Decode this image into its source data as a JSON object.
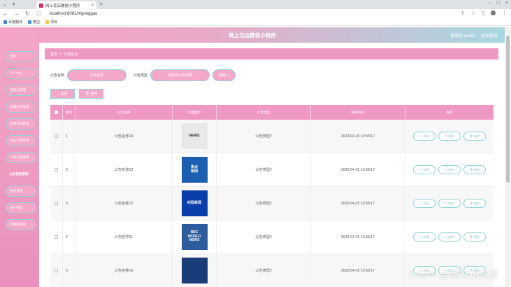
{
  "browser": {
    "tab_title": "网上花店微信小程序",
    "url": "localhost:8081/#/gonggao",
    "bookmarks": [
      {
        "label": "百度翻译",
        "color": "#3b7ddd"
      },
      {
        "label": "爬虫",
        "color": "#4a90e2"
      },
      {
        "label": "项目",
        "color": "#f4c542"
      }
    ]
  },
  "header": {
    "title": "网上花店微信小程序",
    "user": "管理员 admin",
    "logout": "退出登录"
  },
  "sidebar": {
    "items": [
      {
        "label": "首页",
        "has_chevron": false,
        "active": false
      },
      {
        "label": "个人中心",
        "has_chevron": true,
        "active": false
      },
      {
        "label": "管理员管理",
        "has_chevron": true,
        "active": false
      },
      {
        "label": "收藏帖子管理",
        "has_chevron": true,
        "active": false
      },
      {
        "label": "新闻资讯管理",
        "has_chevron": true,
        "active": false
      },
      {
        "label": "论坛信息管理",
        "has_chevron": true,
        "active": false
      },
      {
        "label": "公告信息管理",
        "has_chevron": true,
        "active": false
      },
      {
        "label": "公告信息管理",
        "has_chevron": false,
        "active": true
      },
      {
        "label": "鲜花管理",
        "has_chevron": true,
        "active": false
      },
      {
        "label": "用户管理",
        "has_chevron": true,
        "active": false
      },
      {
        "label": "轮播图管理",
        "has_chevron": true,
        "active": false
      }
    ]
  },
  "breadcrumb": [
    "首页",
    "公告信息"
  ],
  "search": {
    "name_label": "公告名称",
    "name_placeholder": "公告名称",
    "type_label": "公告类型",
    "type_placeholder": "请选择公告类型",
    "button": "搜索"
  },
  "actions": {
    "add": "新增",
    "delete": "删除"
  },
  "table": {
    "headers": [
      "",
      "索引",
      "公告名称",
      "公告图片",
      "公告类型",
      "发布时间",
      "操作"
    ],
    "rows": [
      {
        "idx": "1",
        "name": "公告名称14",
        "type": "公告类型2",
        "time": "2023-04-25 10:58:17",
        "img_text": "NEWS",
        "img_bg": "#e8e8e8",
        "img_color": "#2a2a2a"
      },
      {
        "idx": "2",
        "name": "公告名称13",
        "type": "公告类型2",
        "time": "2023-04-25 10:58:17",
        "img_text": "焦点\n新闻",
        "img_bg": "#1c5fb0",
        "img_color": "#ffffff"
      },
      {
        "idx": "3",
        "name": "公告名称12",
        "type": "公告类型2",
        "time": "2023-04-25 10:58:17",
        "img_text": "时政新闻",
        "img_bg": "#0a3fa8",
        "img_color": "#ffffff"
      },
      {
        "idx": "4",
        "name": "公告名称11",
        "type": "公告类型2",
        "time": "2023-04-25 10:58:17",
        "img_text": "BBC\nWORLD\nNEWS",
        "img_bg": "#2c5b9e",
        "img_color": "#ffffff"
      },
      {
        "idx": "5",
        "name": "公告名称10",
        "type": "公告类型2",
        "time": "2023-04-25 10:58:17",
        "img_text": "",
        "img_bg": "#1a3d7a",
        "img_color": "#ffffff"
      }
    ],
    "ops": [
      "详情",
      "修改",
      "删除"
    ]
  },
  "watermark": "CSDN @晚安独角兽"
}
